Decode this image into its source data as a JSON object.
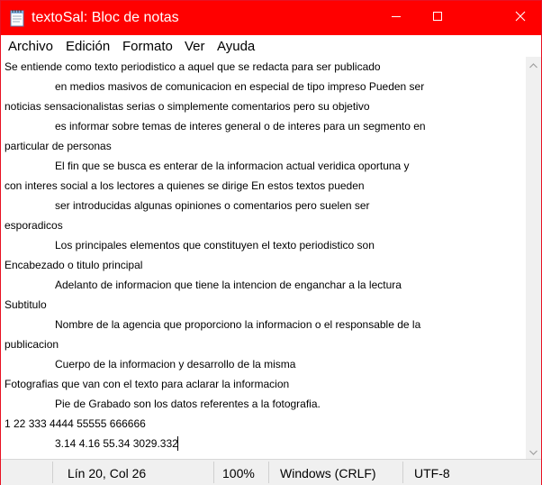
{
  "window": {
    "title": "textoSal: Bloc de notas",
    "title_color": "#ff0000"
  },
  "menu": {
    "items": [
      "Archivo",
      "Edición",
      "Formato",
      "Ver",
      "Ayuda"
    ]
  },
  "editor": {
    "lines": [
      "Se entiende como texto periodistico a aquel que se redacta para ser publicado",
      "en medios masivos de comunicacion en especial de tipo impreso Pueden ser",
      "noticias sensacionalistas serias o simplemente comentarios pero su objetivo",
      "es informar sobre temas de interes general o de interes para un segmento en",
      "particular de personas",
      "El fin que se busca es enterar de la informacion actual veridica oportuna y",
      "con interes social a los lectores a quienes se dirige En estos textos pueden",
      "ser introducidas algunas opiniones o comentarios pero suelen ser",
      "esporadicos",
      "Los principales elementos que constituyen el texto periodistico son",
      "Encabezado o titulo principal",
      "Adelanto de informacion que tiene la intencion de enganchar a la lectura",
      "Subtitulo",
      "Nombre de la agencia que proporciono la informacion o el responsable de la",
      "publicacion",
      "Cuerpo de la informacion y desarrollo de la misma",
      "Fotografias que van con el texto para aclarar la informacion",
      "Pie de Grabado son los datos referentes a la fotografia.",
      "1 22 333 4444 55555 666666",
      "3.14 4.16 55.34 3029.332"
    ]
  },
  "status": {
    "position": "Lín 20, Col 26",
    "zoom": "100%",
    "line_ending": "Windows (CRLF)",
    "encoding": "UTF-8"
  },
  "icons": {
    "app": "notepad-icon",
    "minimize": "minimize-icon",
    "maximize": "maximize-icon",
    "close": "close-icon",
    "scroll_up": "chevron-up-icon",
    "scroll_down": "chevron-down-icon"
  }
}
